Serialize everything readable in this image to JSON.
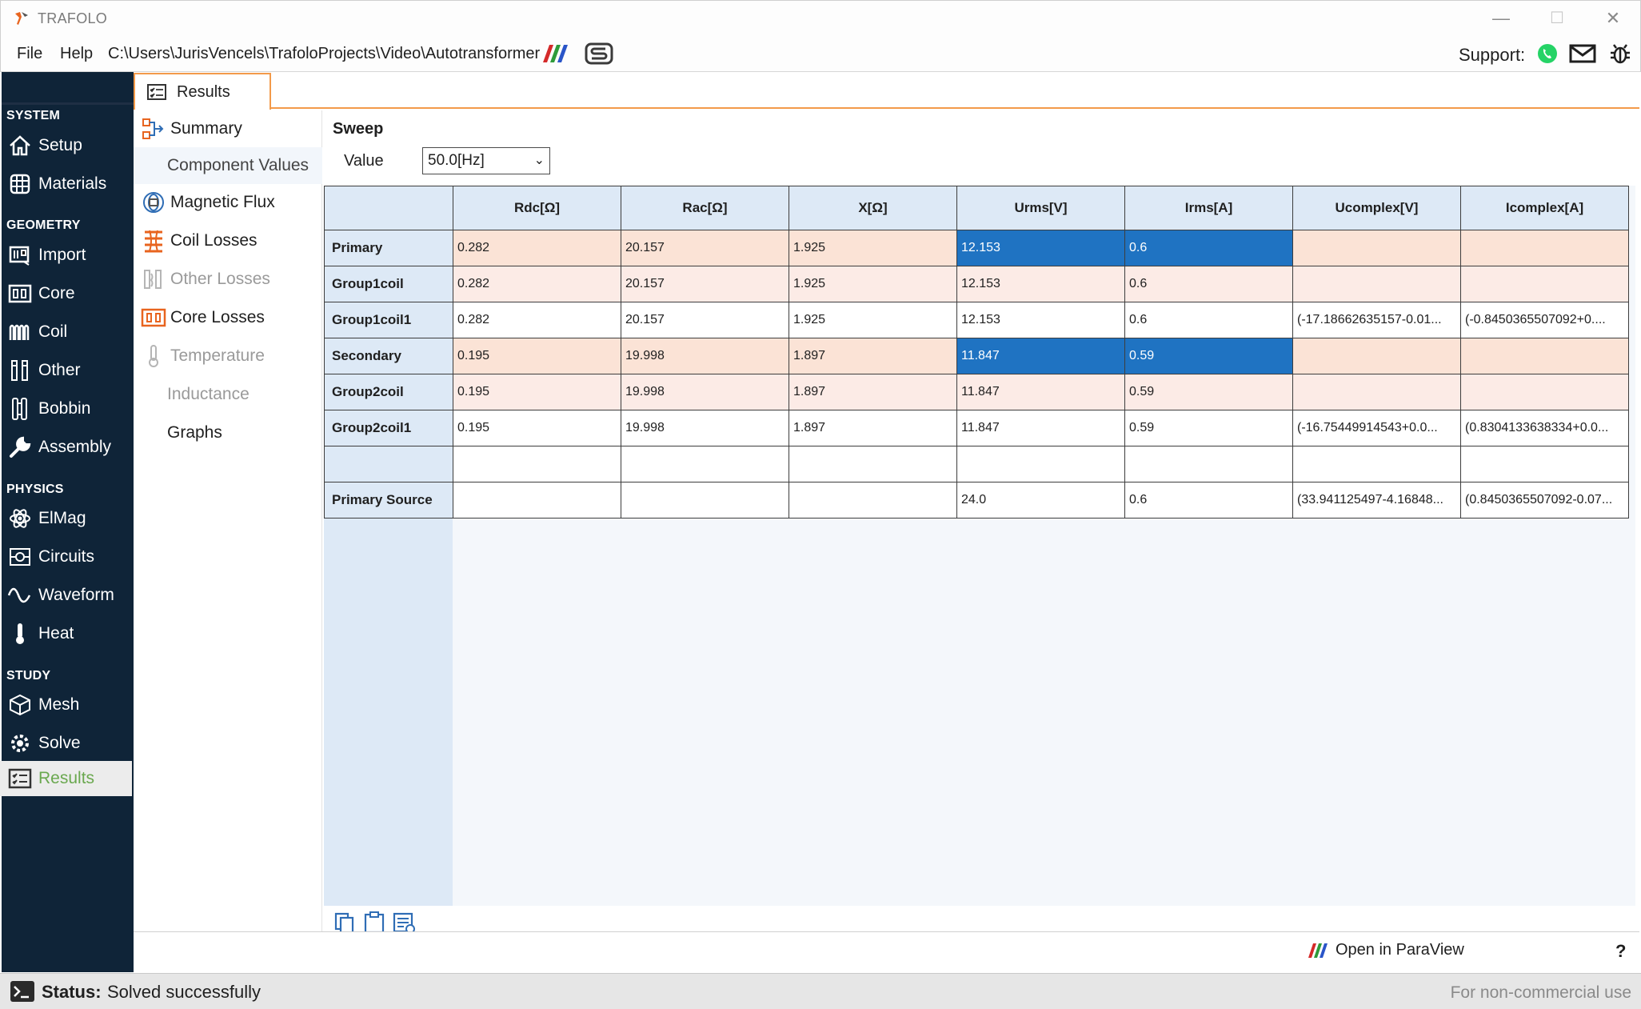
{
  "window": {
    "title": "TRAFOLO",
    "minimize": "—",
    "maximize": "☐",
    "close": "✕"
  },
  "menubar": {
    "file": "File",
    "help": "Help",
    "project_path": "C:\\Users\\JurisVencels\\TrafoloProjects\\Video\\Autotransformer",
    "support_label": "Support:"
  },
  "nav": {
    "sections": {
      "system": "SYSTEM",
      "geometry": "GEOMETRY",
      "physics": "PHYSICS",
      "study": "STUDY"
    },
    "items": {
      "setup": "Setup",
      "materials": "Materials",
      "import": "Import",
      "core": "Core",
      "coil": "Coil",
      "other": "Other",
      "bobbin": "Bobbin",
      "assembly": "Assembly",
      "elmag": "ElMag",
      "circuits": "Circuits",
      "waveform": "Waveform",
      "heat": "Heat",
      "mesh": "Mesh",
      "solve": "Solve",
      "results": "Results"
    },
    "active": "results"
  },
  "tab": {
    "label": "Results"
  },
  "results_list": {
    "summary": "Summary",
    "component_values": "Component Values",
    "magnetic_flux": "Magnetic Flux",
    "coil_losses": "Coil Losses",
    "other_losses": "Other Losses",
    "core_losses": "Core Losses",
    "temperature": "Temperature",
    "inductance": "Inductance",
    "graphs": "Graphs",
    "selected": "component_values"
  },
  "sweep": {
    "title": "Sweep",
    "value_label": "Value",
    "value_selected": "50.0[Hz]"
  },
  "table": {
    "columns": [
      "Rdc[Ω]",
      "Rac[Ω]",
      "X[Ω]",
      "Urms[V]",
      "Irms[A]",
      "Ucomplex[V]",
      "Icomplex[A]"
    ],
    "rows": [
      {
        "name": "Primary",
        "cells": [
          "0.282",
          "20.157",
          "1.925",
          "12.153",
          "0.6",
          "",
          ""
        ]
      },
      {
        "name": "Group1coil",
        "cells": [
          "0.282",
          "20.157",
          "1.925",
          "12.153",
          "0.6",
          "",
          ""
        ]
      },
      {
        "name": "Group1coil1",
        "cells": [
          "0.282",
          "20.157",
          "1.925",
          "12.153",
          "0.6",
          "(-17.18662635157-0.01...",
          "(-0.8450365507092+0...."
        ]
      },
      {
        "name": "Secondary",
        "cells": [
          "0.195",
          "19.998",
          "1.897",
          "11.847",
          "0.59",
          "",
          ""
        ]
      },
      {
        "name": "Group2coil",
        "cells": [
          "0.195",
          "19.998",
          "1.897",
          "11.847",
          "0.59",
          "",
          ""
        ]
      },
      {
        "name": "Group2coil1",
        "cells": [
          "0.195",
          "19.998",
          "1.897",
          "11.847",
          "0.59",
          "(-16.75449914543+0.0...",
          "(0.8304133638334+0.0..."
        ]
      },
      {
        "name": "",
        "cells": [
          "",
          "",
          "",
          "",
          "",
          "",
          ""
        ]
      },
      {
        "name": "Primary Source",
        "cells": [
          "",
          "",
          "",
          "24.0",
          "0.6",
          "(33.941125497-4.16848...",
          "(0.8450365507092-0.07..."
        ]
      }
    ],
    "selected_cells": [
      "Primary:Urms[V]",
      "Primary:Irms[A]",
      "Secondary:Urms[V]",
      "Secondary:Irms[A]"
    ]
  },
  "footer": {
    "paraview": "Open in ParaView",
    "help": "?",
    "status_label": "Status:",
    "status_value": "Solved successfully",
    "license_note": "For non-commercial use"
  },
  "colors": {
    "nav_bg": "#0f2438",
    "accent_orange": "#f39a4a",
    "selection_blue": "#1f73c2",
    "results_active_green": "#6aa84f",
    "row_tint_primary": "#fbe3d6",
    "row_tint_group": "#fcebe6"
  }
}
